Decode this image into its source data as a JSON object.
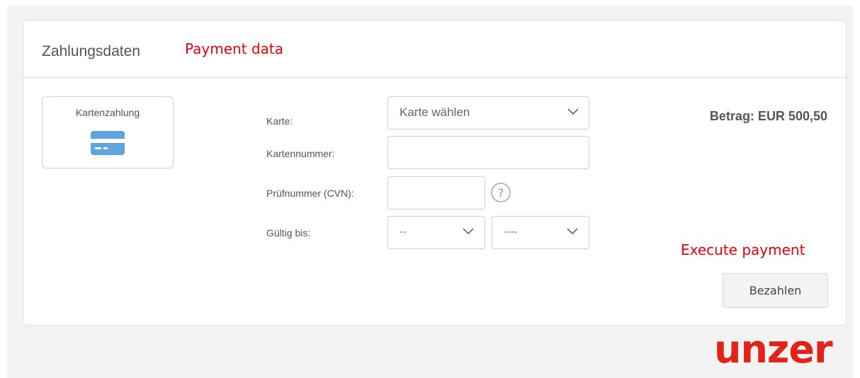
{
  "header": {
    "title": "Zahlungsdaten",
    "annotation": "Payment data"
  },
  "payment_method": {
    "label": "Kartenzahlung",
    "icon": "credit-card-icon"
  },
  "form": {
    "card_label": "Karte:",
    "card_select_value": "Karte wählen",
    "card_number_label": "Kartennummer:",
    "card_number_value": "",
    "cvn_label": "Prüfnummer (CVN):",
    "cvn_value": "",
    "valid_until_label": "Gültig bis:",
    "month_value": "--",
    "year_value": "----"
  },
  "amount": "Betrag: EUR 500,50",
  "execute_annotation": "Execute payment",
  "pay_button_label": "Bezahlen",
  "logo_text": "unzer",
  "colors": {
    "annotation": "#e8000b",
    "logo": "#e2231a",
    "card_icon": "#5ea4dd"
  }
}
